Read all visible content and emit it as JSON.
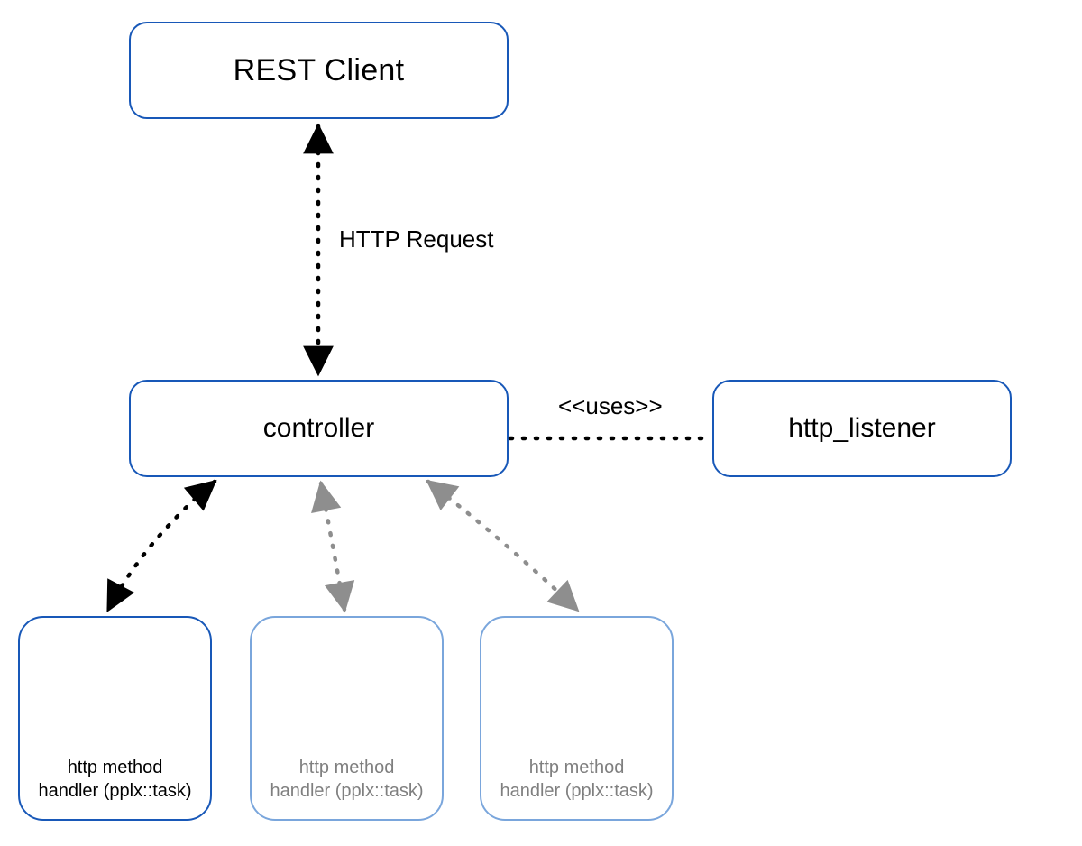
{
  "nodes": {
    "rest_client": {
      "label": "REST Client"
    },
    "controller": {
      "label": "controller"
    },
    "http_listener": {
      "label": "http_listener"
    },
    "handler1": {
      "label_l1": "http method",
      "label_l2": "handler (pplx::task)"
    },
    "handler2": {
      "label_l1": "http method",
      "label_l2": "handler (pplx::task)"
    },
    "handler3": {
      "label_l1": "http method",
      "label_l2": "handler (pplx::task)"
    }
  },
  "edges": {
    "http_request": {
      "label": "HTTP Request"
    },
    "uses": {
      "label": "<<uses>>"
    }
  },
  "colors": {
    "node_primary": "#1858b8",
    "node_faded": "#7aa6dc",
    "arrow_dark": "#000000",
    "arrow_faded": "#8e8e8e"
  }
}
